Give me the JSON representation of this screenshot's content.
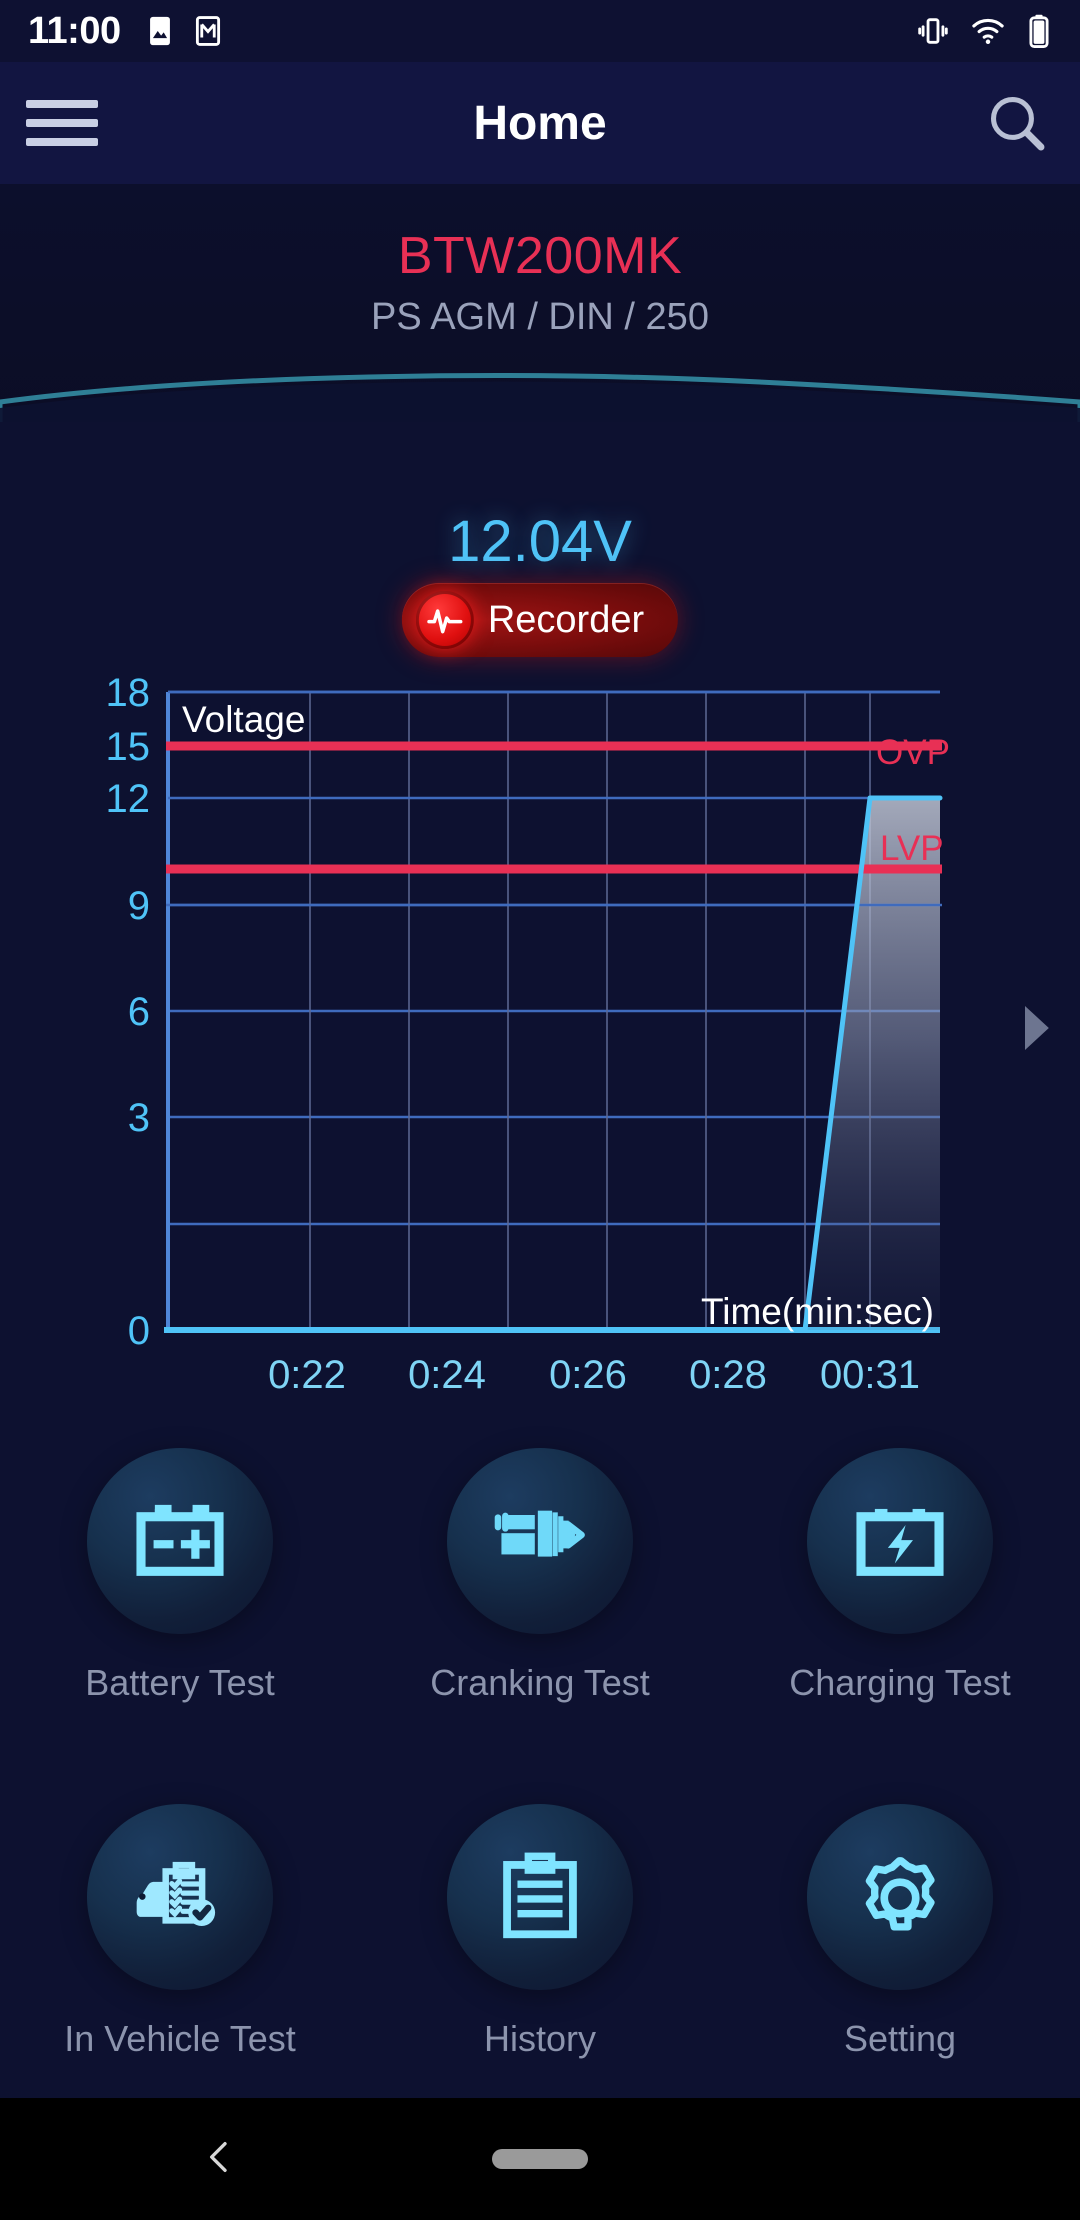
{
  "statusbar": {
    "time": "11:00",
    "icons": [
      "photos-icon",
      "gmail-icon",
      "vibrate-icon",
      "wifi-icon",
      "battery-icon"
    ]
  },
  "appbar": {
    "title": "Home",
    "menu_icon": "hamburger-menu-icon",
    "search_icon": "search-icon"
  },
  "device": {
    "name": "BTW200MK",
    "spec": "PS AGM / DIN / 250"
  },
  "reading": {
    "voltage": "12.04V"
  },
  "recorder": {
    "label": "Recorder",
    "icon": "pulse-icon"
  },
  "colors": {
    "accent_cyan": "#4fc3f7",
    "accent_crimson": "#e83055",
    "background": "#0d1130",
    "grid_blue": "#2f5aa8",
    "label_grey": "#8c94ad"
  },
  "chart_data": {
    "type": "line",
    "title": "Voltage",
    "xlabel": "Time(min:sec)",
    "ylabel": "Voltage",
    "ylim": [
      0,
      18
    ],
    "yticks": [
      0,
      3,
      6,
      9,
      12,
      15,
      18
    ],
    "xticks": [
      "0:22",
      "0:24",
      "0:26",
      "0:28",
      "00:31"
    ],
    "grid": true,
    "legend": "none",
    "series": [
      {
        "name": "Voltage",
        "color": "#4fc3f7",
        "x": [
          "0:21",
          "0:29.4",
          "0:30.2",
          "00:31"
        ],
        "values": [
          0,
          0,
          12.04,
          12.04
        ]
      }
    ],
    "threshold_lines": [
      {
        "label": "OVP",
        "value": 15,
        "color": "#e83055"
      },
      {
        "label": "LVP",
        "value": 10,
        "color": "#e83055"
      }
    ],
    "annotations": [
      {
        "text": "Voltage",
        "position": "top-left"
      },
      {
        "text": "Time(min:sec)",
        "position": "bottom-right"
      }
    ]
  },
  "grid_tiles": [
    {
      "label": "Battery Test",
      "icon": "battery-plus-minus-icon"
    },
    {
      "label": "Cranking Test",
      "icon": "starter-motor-icon"
    },
    {
      "label": "Charging Test",
      "icon": "battery-bolt-icon"
    },
    {
      "label": "In Vehicle Test",
      "icon": "car-checklist-icon"
    },
    {
      "label": "History",
      "icon": "clipboard-lines-icon"
    },
    {
      "label": "Setting",
      "icon": "gear-icon"
    }
  ],
  "pager": {
    "next_icon": "chevron-right-icon"
  },
  "navbar": {
    "back_icon": "chevron-left-icon",
    "home_pill": "home-pill-handle"
  }
}
